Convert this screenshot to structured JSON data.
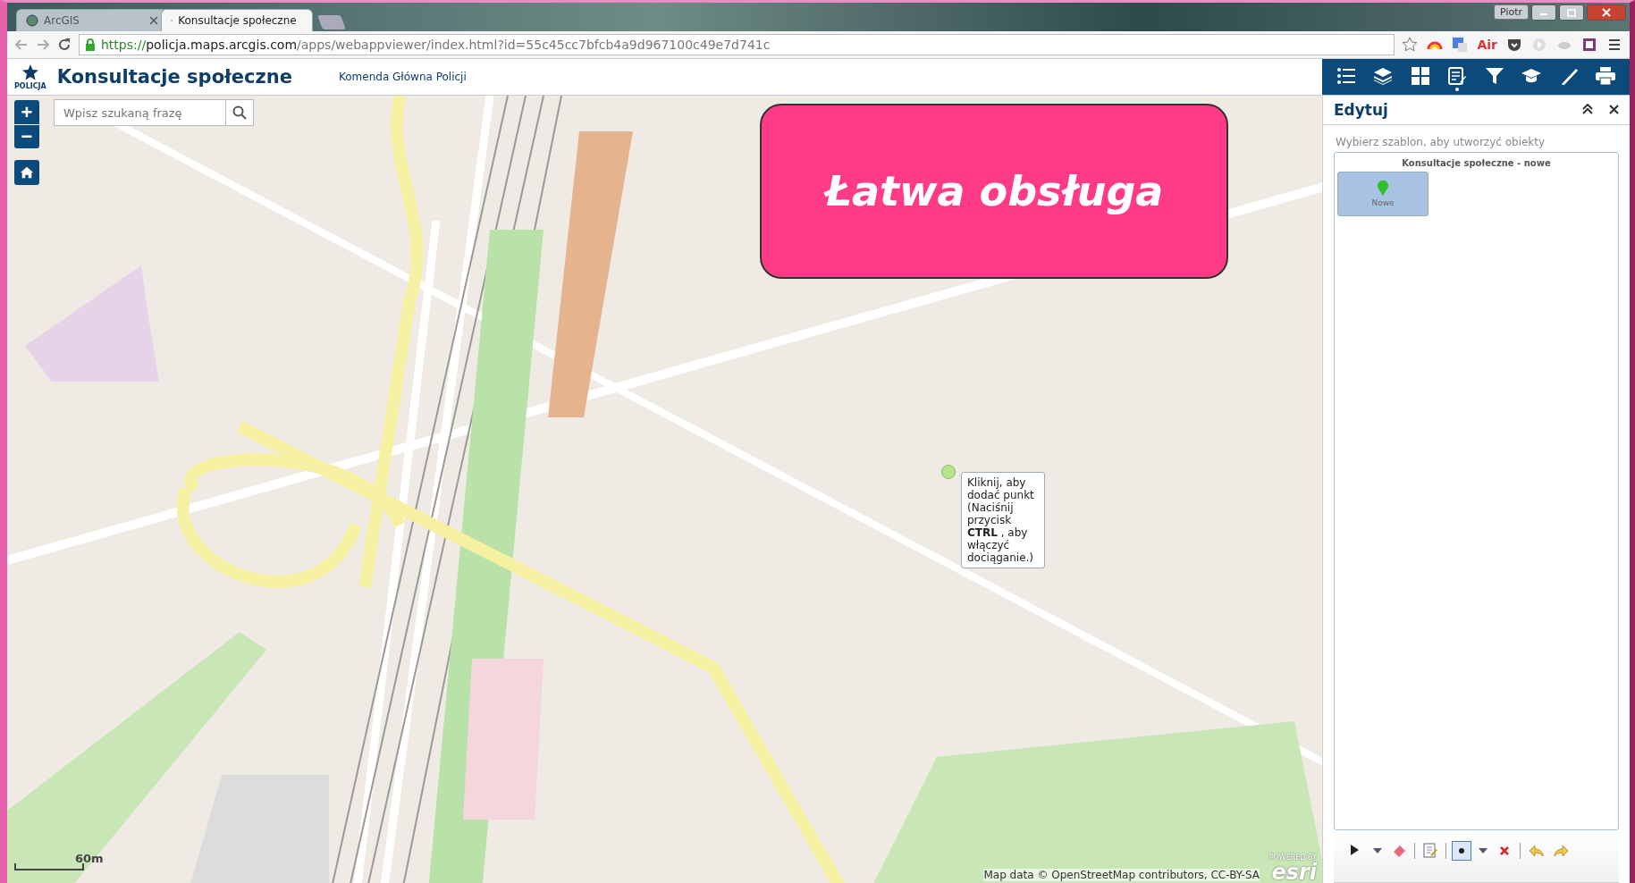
{
  "browser": {
    "tabs": [
      {
        "label": "ArcGIS",
        "selected": false
      },
      {
        "label": "Konsultacje społeczne",
        "selected": true
      }
    ],
    "user": "Piotr",
    "url": {
      "scheme": "https://",
      "host": "policja.maps.arcgis.com",
      "path": "/apps/webappviewer/index.html?id=55c45cc7bfcb4a9d967100c49e7d741c"
    },
    "extension_label": "Air"
  },
  "app": {
    "logo_caption": "POLICJA",
    "title": "Konsultacje społeczne",
    "subtitle": "Komenda Główna Policji"
  },
  "toolbar": {
    "tools": [
      {
        "kind": "list",
        "selected": false
      },
      {
        "kind": "layers",
        "selected": false
      },
      {
        "kind": "grid",
        "selected": false
      },
      {
        "kind": "edit",
        "selected": true
      },
      {
        "kind": "filter",
        "selected": false
      },
      {
        "kind": "cap",
        "selected": false
      },
      {
        "kind": "ruler",
        "selected": false
      },
      {
        "kind": "print",
        "selected": false
      }
    ]
  },
  "map": {
    "zoom_in": "+",
    "zoom_out": "−",
    "search": {
      "placeholder": "Wpisz szukaną frazę"
    },
    "callout": "Łatwa obsługa",
    "tooltip": "Kliknij, aby dodać punkt (Naciśnij przycisk **CTRL** , aby włączyć dociąganie.)",
    "scale": "60m",
    "attribution": "Map data © OpenStreetMap contributors, CC-BY-SA",
    "esri_caption": "POWERED BY",
    "esri": "esri"
  },
  "panel": {
    "title": "Edytuj",
    "hint": "Wybierz szablon, aby utworzyć obiekty",
    "group": "Konsultacje społeczne - nowe",
    "templates": [
      {
        "label": "Nowe",
        "selected": true
      }
    ],
    "tools": [
      {
        "kind": "select"
      },
      {
        "kind": "caret"
      },
      {
        "kind": "eraser"
      },
      {
        "kind": "sep"
      },
      {
        "kind": "attributes"
      },
      {
        "kind": "sep"
      },
      {
        "kind": "point",
        "selected": true
      },
      {
        "kind": "caret"
      },
      {
        "kind": "delete"
      },
      {
        "kind": "sep"
      },
      {
        "kind": "undo"
      },
      {
        "kind": "redo"
      }
    ]
  }
}
